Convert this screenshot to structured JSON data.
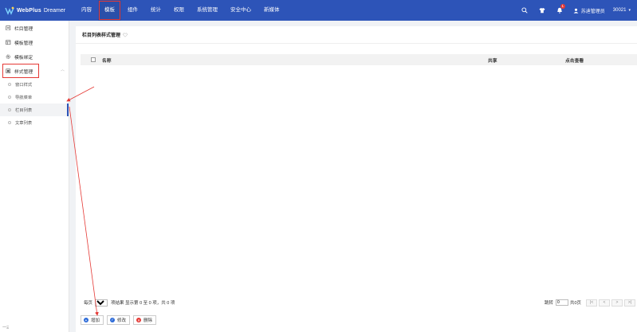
{
  "header": {
    "brand": "WebPlus",
    "brand_sub": "Dreamer",
    "nav": [
      {
        "label": "内容"
      },
      {
        "label": "模板",
        "active": true
      },
      {
        "label": "组件"
      },
      {
        "label": "统计"
      },
      {
        "label": "权限"
      },
      {
        "label": "系统管理"
      },
      {
        "label": "安全中心"
      },
      {
        "label": "新媒体"
      }
    ],
    "notification_count": "1",
    "user_name": "苏迪管理员",
    "user_id": "30021"
  },
  "sidebar": {
    "items": [
      {
        "label": "栏目管理",
        "icon": "doc-icon"
      },
      {
        "label": "模板管理",
        "icon": "template-icon"
      },
      {
        "label": "模板绑定",
        "icon": "gear-icon"
      },
      {
        "label": "样式管理",
        "icon": "style-icon",
        "expanded": true
      }
    ],
    "sub_items": [
      {
        "label": "窗口样式"
      },
      {
        "label": "导航菜单"
      },
      {
        "label": "栏目列表",
        "active": true
      },
      {
        "label": "文章列表"
      }
    ],
    "bottom_text": "一Ξ"
  },
  "main": {
    "title": "栏目列表样式管理",
    "columns": {
      "name": "名称",
      "share": "共享",
      "view": "点击查看"
    },
    "pager": {
      "per_page_label": "每页",
      "per_page_value": "20",
      "info": "项结果 显示第 0 至 0 项，共 0 项",
      "jump_label": "跳转",
      "jump_value": "0",
      "pages": "共0页",
      "first": "|<",
      "prev": "<",
      "next": ">",
      "last": ">|"
    },
    "actions": {
      "add": "增加",
      "edit": "修改",
      "delete": "删除"
    }
  },
  "colors": {
    "header_bg": "#2d54b8",
    "highlight": "#e53935",
    "active_bar": "#2d54b8"
  }
}
